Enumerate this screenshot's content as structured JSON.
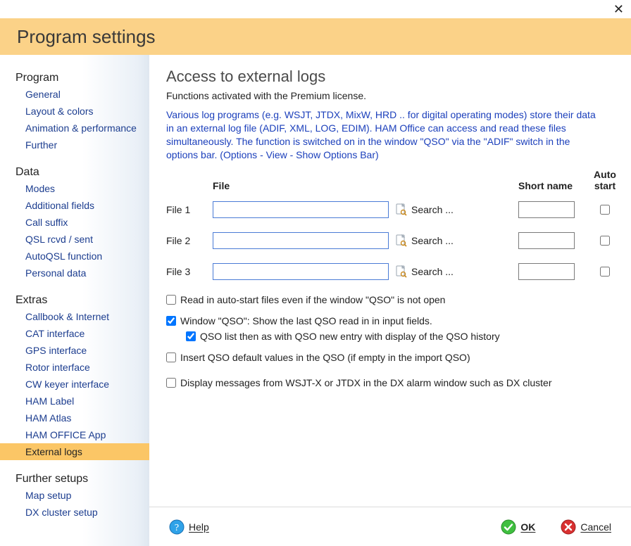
{
  "banner": {
    "title": "Program settings"
  },
  "sidebar": {
    "groups": [
      {
        "label": "Program",
        "items": [
          "General",
          "Layout & colors",
          "Animation & performance",
          "Further"
        ]
      },
      {
        "label": "Data",
        "items": [
          "Modes",
          "Additional fields",
          "Call suffix",
          "QSL rcvd / sent",
          "AutoQSL function",
          "Personal data"
        ]
      },
      {
        "label": "Extras",
        "items": [
          "Callbook & Internet",
          "CAT interface",
          "GPS interface",
          "Rotor interface",
          "CW keyer interface",
          "HAM Label",
          "HAM Atlas",
          "HAM OFFICE App",
          "External logs"
        ],
        "selected_index": 8
      },
      {
        "label": "Further setups",
        "items": [
          "Map setup",
          "DX cluster setup"
        ]
      }
    ]
  },
  "page": {
    "title": "Access to external logs",
    "subtitle": "Functions activated with the Premium license.",
    "description": "Various log programs (e.g. WSJT, JTDX, MixW, HRD .. for digital operating modes) store their data in an external log file (ADIF, XML, LOG, EDIM). HAM Office can access and read these files simultaneously. The function is switched on in the window \"QSO\" via the \"ADIF\" switch in the options bar. (Options - View - Show Options Bar)"
  },
  "table": {
    "headers": {
      "file": "File",
      "short": "Short name",
      "auto": "Auto start"
    },
    "search_label": "Search ...",
    "rows": [
      {
        "label": "File 1",
        "file": "",
        "short": "",
        "auto": false
      },
      {
        "label": "File 2",
        "file": "",
        "short": "",
        "auto": false
      },
      {
        "label": "File 3",
        "file": "",
        "short": "",
        "auto": false
      }
    ]
  },
  "options": {
    "opt1": {
      "checked": false,
      "label": "Read in auto-start files even if the window \"QSO\" is not open"
    },
    "opt2": {
      "checked": true,
      "label": "Window \"QSO\": Show the last QSO read in in input fields."
    },
    "opt2a": {
      "checked": true,
      "label": "QSO list then as with QSO new entry with display of the QSO history"
    },
    "opt3": {
      "checked": false,
      "label": "Insert QSO default values in the QSO (if empty in the import QSO)"
    },
    "opt4": {
      "checked": false,
      "label": "Display messages from WSJT-X or JTDX in the DX alarm window such as DX cluster"
    }
  },
  "footer": {
    "help": "Help",
    "ok": "OK",
    "cancel": "Cancel"
  }
}
